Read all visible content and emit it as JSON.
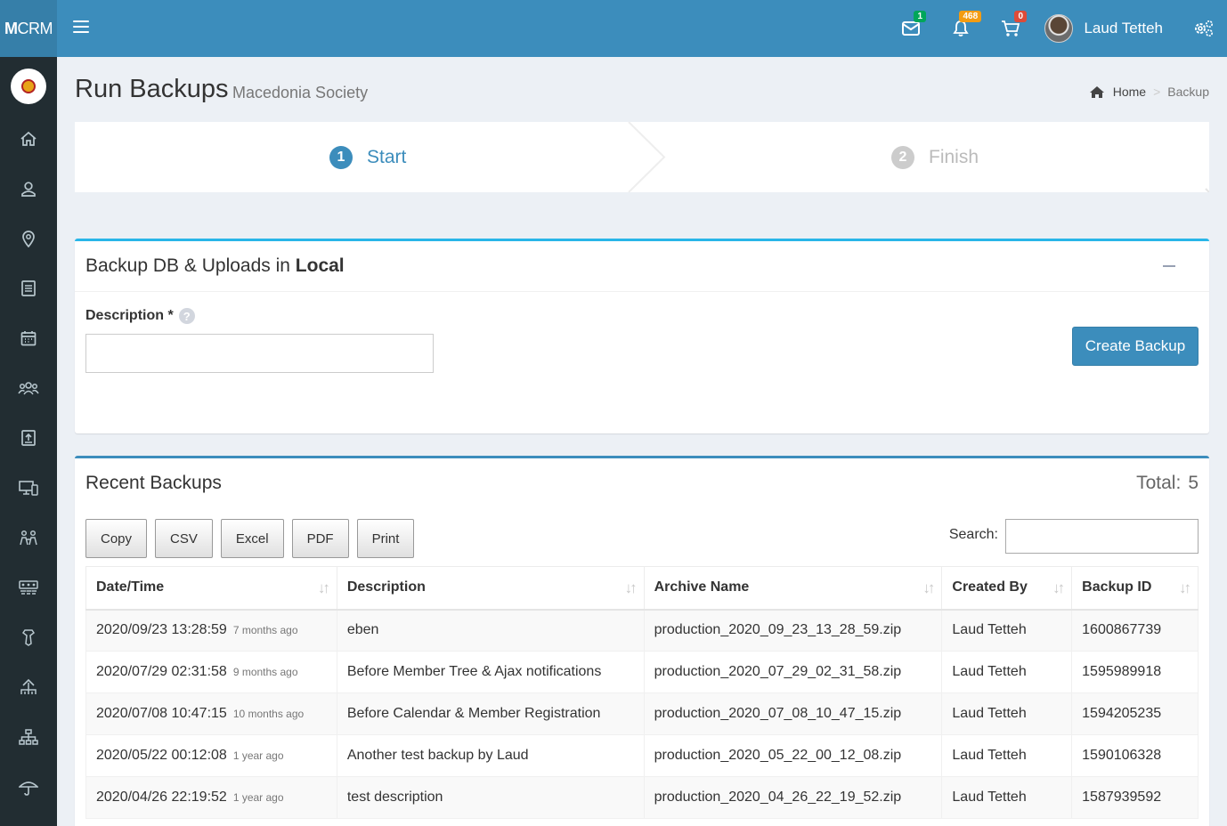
{
  "header": {
    "logo_bold": "M",
    "logo_rest": "CRM",
    "mail_count": "1",
    "notif_count": "468",
    "cart_count": "0",
    "user_name": "Laud Tetteh"
  },
  "page": {
    "title": "Run Backups",
    "subtitle": "Macedonia Society",
    "breadcrumb_home": "Home",
    "breadcrumb_current": "Backup"
  },
  "wizard": {
    "steps": [
      {
        "num": "1",
        "label": "Start"
      },
      {
        "num": "2",
        "label": "Finish"
      }
    ]
  },
  "backup_box": {
    "title_prefix": "Backup DB & Uploads in ",
    "title_bold": "Local",
    "description_label": "Description *",
    "help": "?",
    "description_value": "",
    "create_label": "Create Backup"
  },
  "recent": {
    "title": "Recent Backups",
    "total_label": "Total:",
    "total_value": "5",
    "buttons": [
      "Copy",
      "CSV",
      "Excel",
      "PDF",
      "Print"
    ],
    "search_label": "Search:",
    "columns": [
      "Date/Time",
      "Description",
      "Archive Name",
      "Created By",
      "Backup ID"
    ],
    "rows": [
      {
        "datetime": "2020/09/23 13:28:59",
        "ago": "7 months ago",
        "description": "eben",
        "archive": "production_2020_09_23_13_28_59.zip",
        "created_by": "Laud Tetteh",
        "id": "1600867739"
      },
      {
        "datetime": "2020/07/29 02:31:58",
        "ago": "9 months ago",
        "description": "Before Member Tree & Ajax notifications",
        "archive": "production_2020_07_29_02_31_58.zip",
        "created_by": "Laud Tetteh",
        "id": "1595989918"
      },
      {
        "datetime": "2020/07/08 10:47:15",
        "ago": "10 months ago",
        "description": "Before Calendar & Member Registration",
        "archive": "production_2020_07_08_10_47_15.zip",
        "created_by": "Laud Tetteh",
        "id": "1594205235"
      },
      {
        "datetime": "2020/05/22 00:12:08",
        "ago": "1 year ago",
        "description": "Another test backup by Laud",
        "archive": "production_2020_05_22_00_12_08.zip",
        "created_by": "Laud Tetteh",
        "id": "1590106328"
      },
      {
        "datetime": "2020/04/26 22:19:52",
        "ago": "1 year ago",
        "description": "test description",
        "archive": "production_2020_04_26_22_19_52.zip",
        "created_by": "Laud Tetteh",
        "id": "1587939592"
      }
    ]
  },
  "sidebar": {
    "icons": [
      "home-icon",
      "user-icon",
      "map-pin-icon",
      "document-icon",
      "calendar-icon",
      "groups-icon",
      "upload-box-icon",
      "devices-icon",
      "people-meeting-icon",
      "seating-icon",
      "tie-icon",
      "hierarchy-home-icon",
      "sitemap-icon",
      "umbrella-icon"
    ]
  },
  "colors": {
    "header": "#3c8dbc",
    "logo_bg": "#367fa9",
    "sidebar": "#222d32",
    "accent": "#3c8dbc",
    "box1_border": "#29b6e8"
  }
}
